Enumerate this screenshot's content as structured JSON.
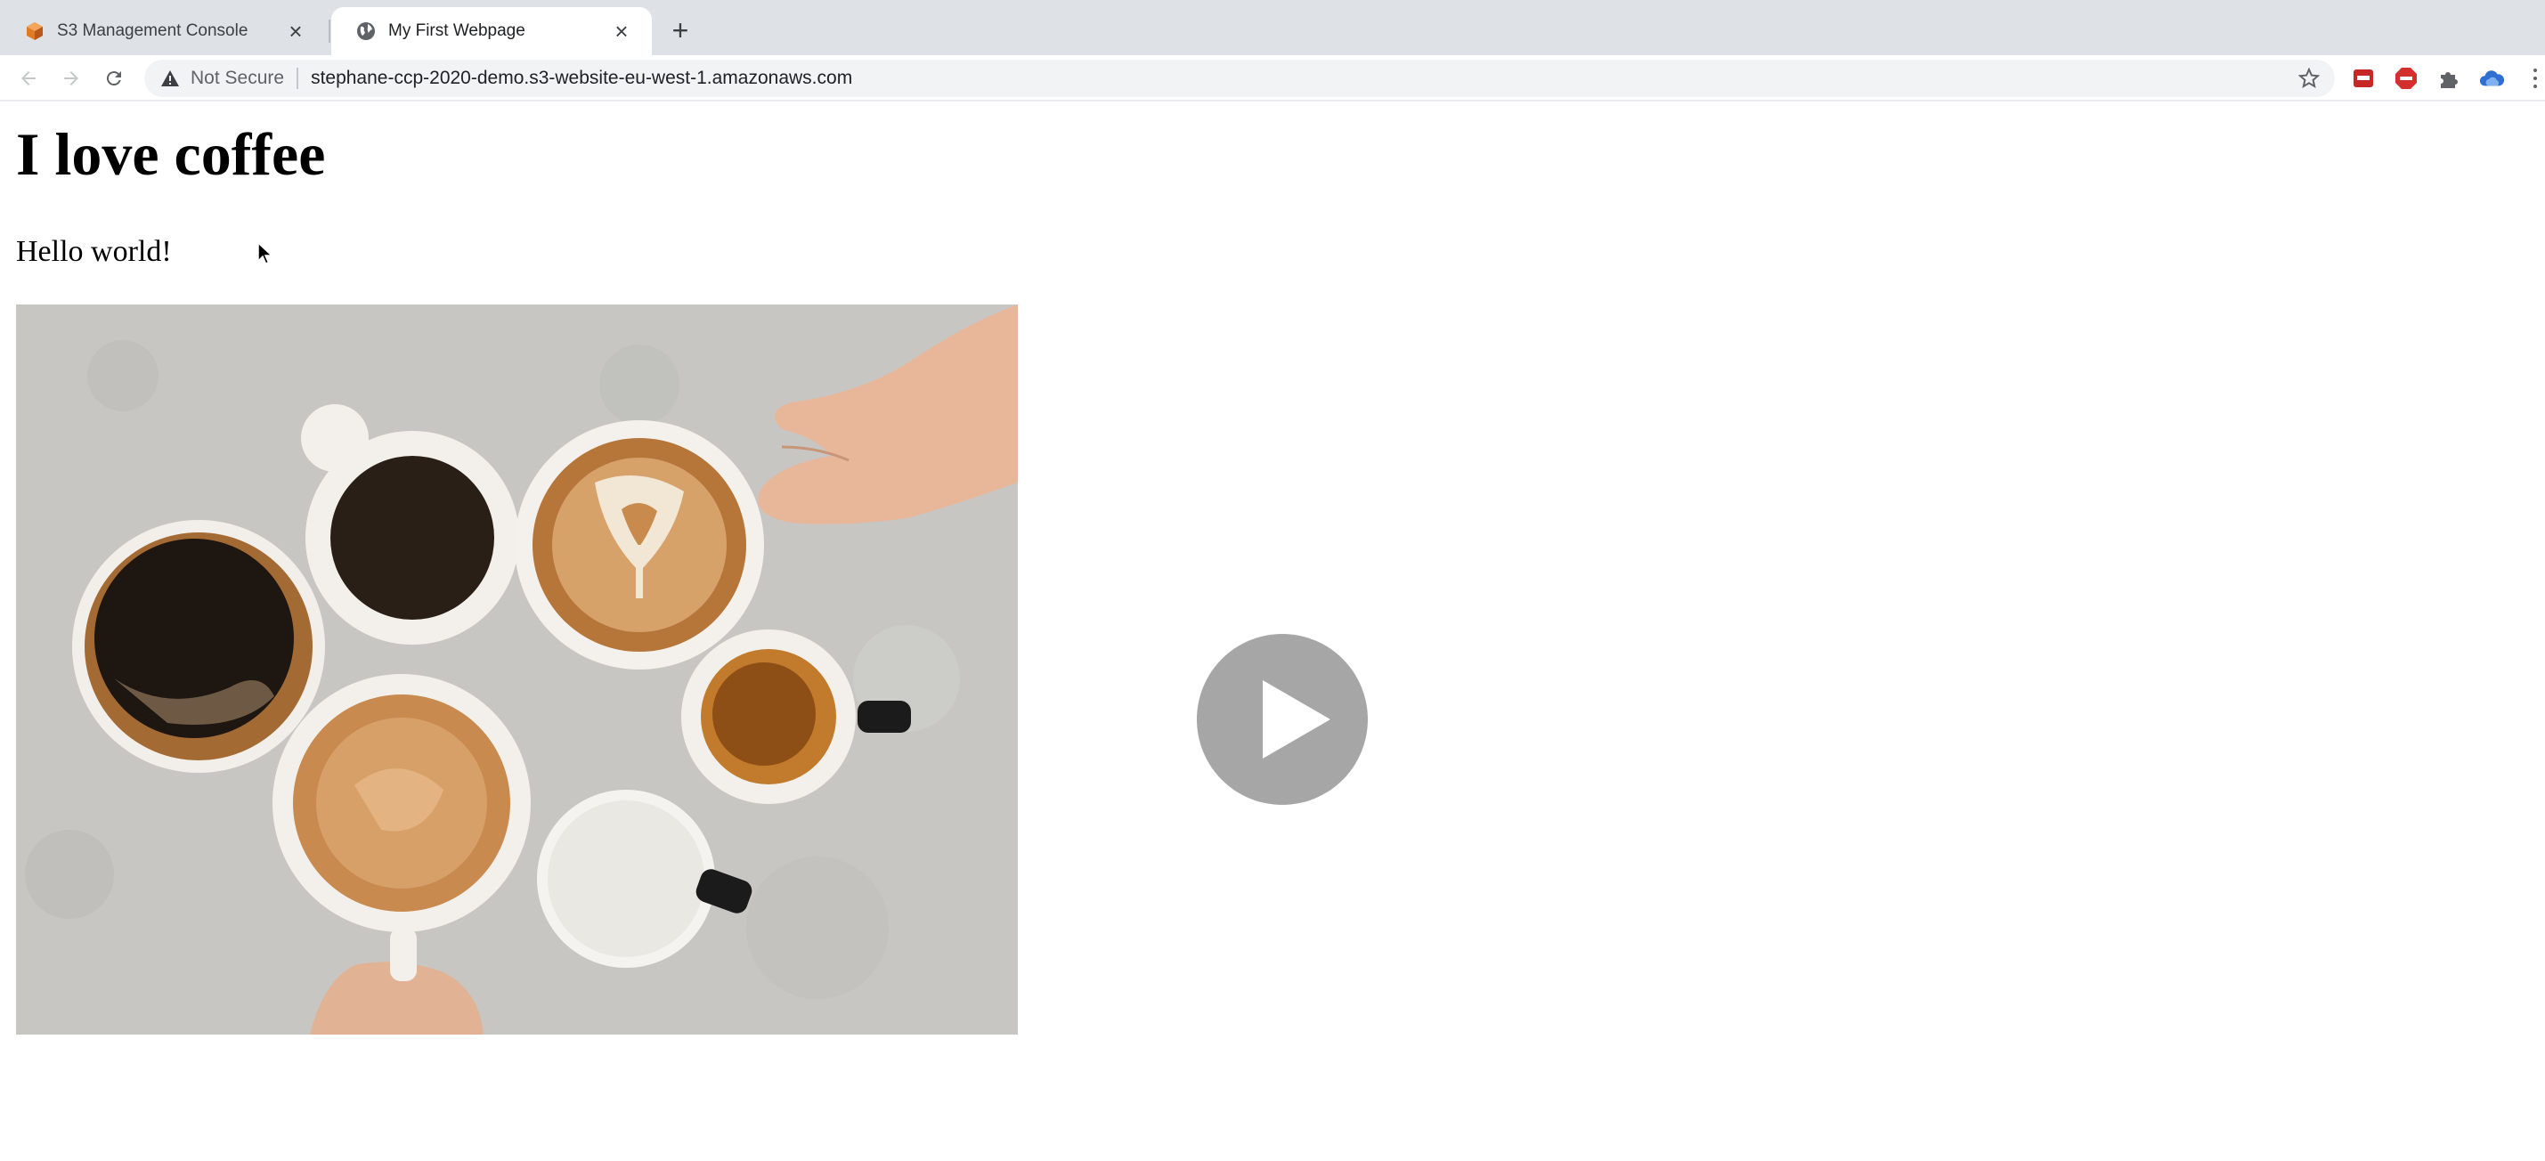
{
  "browser": {
    "tabs": [
      {
        "title": "S3 Management Console",
        "icon": "aws-s3-icon",
        "active": false
      },
      {
        "title": "My First Webpage",
        "icon": "globe-icon",
        "active": true
      }
    ],
    "close_glyph": "×",
    "new_tab_glyph": "+",
    "address_bar": {
      "security_label": "Not Secure",
      "url": "stephane-ccp-2020-demo.s3-website-eu-west-1.amazonaws.com"
    },
    "extensions": [
      "red-extension-icon",
      "adblock-icon",
      "puzzle-extensions-icon",
      "cloud-extension-icon"
    ]
  },
  "page": {
    "heading": "I love coffee",
    "paragraph": "Hello world!",
    "image": {
      "subject": "coffee-cups-photo"
    }
  },
  "overlay": {
    "icon": "play-icon"
  },
  "colors": {
    "tabstrip": "#dee1e6",
    "omnibox": "#f1f3f4",
    "play_button": "#a6a6a6",
    "photo_background": "#c7c6c2"
  }
}
